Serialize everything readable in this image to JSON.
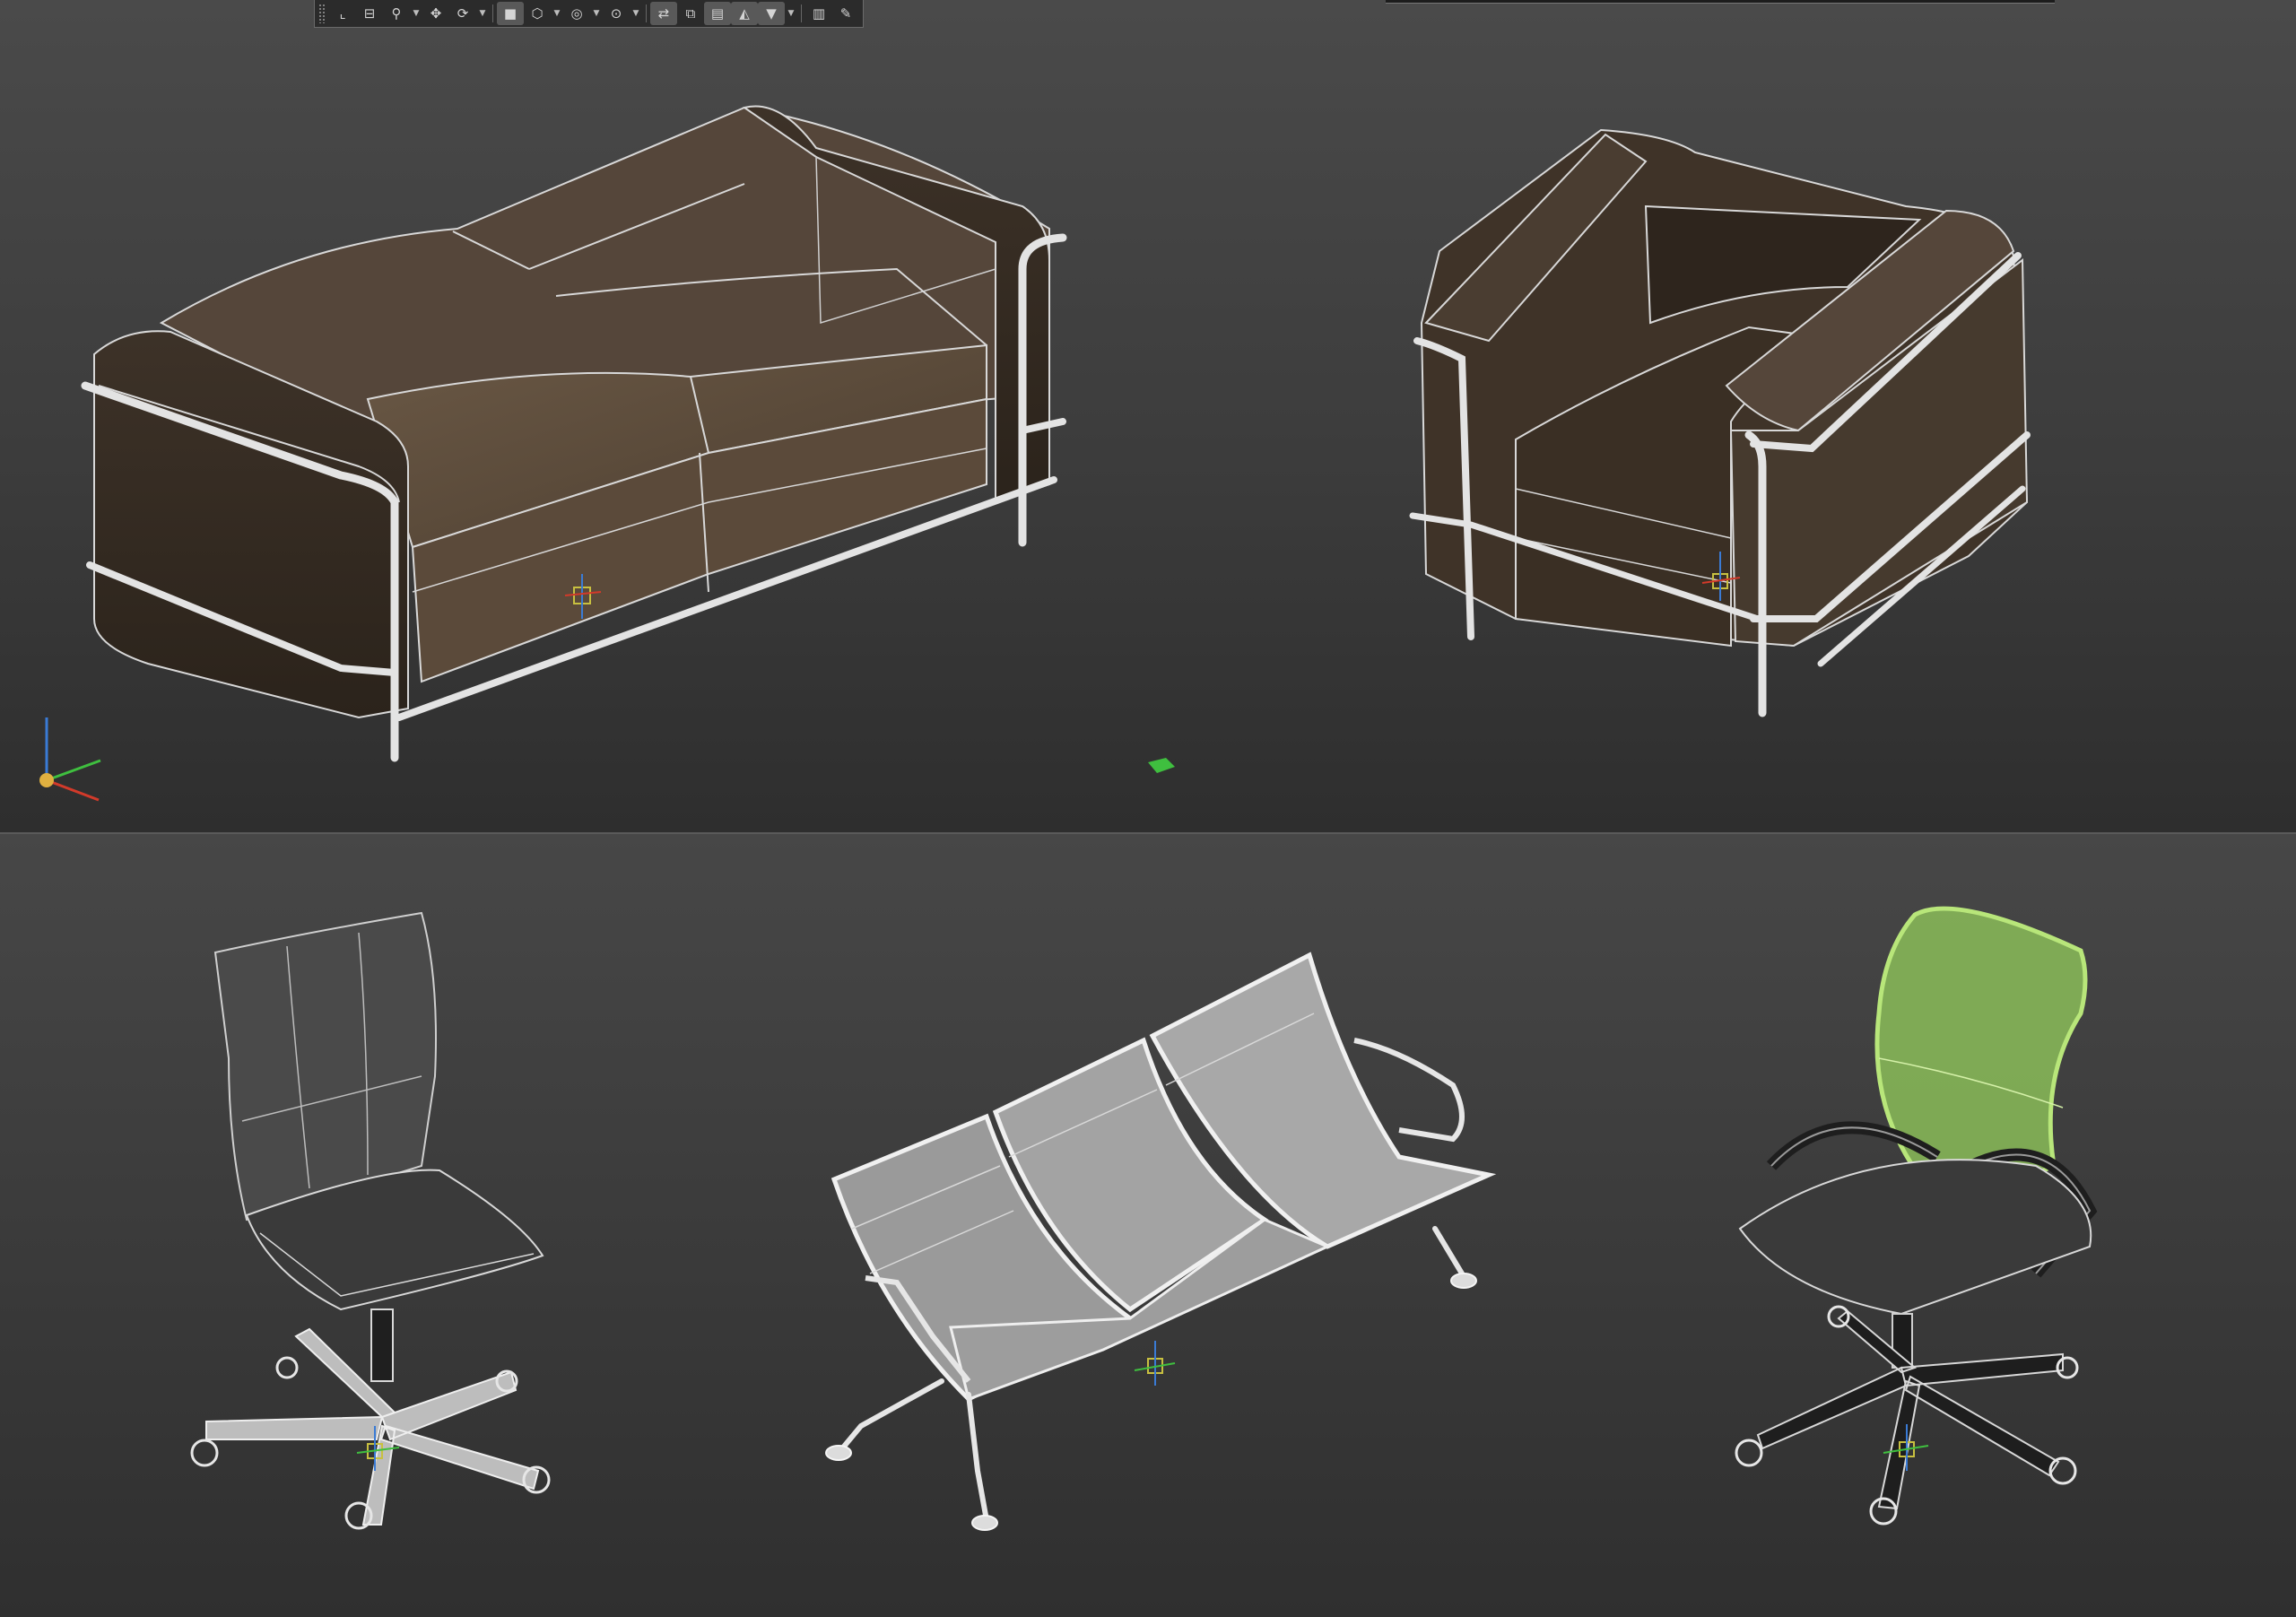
{
  "app": {
    "name": "3D modeling viewport"
  },
  "toolbar": {
    "buttons": [
      {
        "name": "select-object-icon",
        "glyph": "⌞"
      },
      {
        "name": "select-by-name-icon",
        "glyph": "⊟"
      },
      {
        "name": "zoom-icon",
        "glyph": "⚲",
        "dropdown": true
      },
      {
        "name": "pan-icon",
        "glyph": "✥"
      },
      {
        "name": "orbit-icon",
        "glyph": "⟳",
        "dropdown": true
      },
      {
        "name": "shaded-mode-icon",
        "glyph": "■",
        "active": true
      },
      {
        "name": "wireframe-mode-icon",
        "glyph": "⬡",
        "dropdown": true
      },
      {
        "name": "isolate-icon",
        "glyph": "◎",
        "dropdown": true
      },
      {
        "name": "hide-icon",
        "glyph": "⊙",
        "dropdown": true
      },
      {
        "name": "snap-icon",
        "glyph": "⇄",
        "active": true
      },
      {
        "name": "align-icon",
        "glyph": "⧉"
      },
      {
        "name": "layer-manager-icon",
        "glyph": "▤",
        "active": true
      },
      {
        "name": "scene-explorer-icon",
        "glyph": "◭",
        "active": true
      },
      {
        "name": "filter-icon",
        "glyph": "▼",
        "active": true,
        "dropdown": true
      },
      {
        "name": "render-setup-icon",
        "glyph": "▥"
      },
      {
        "name": "eyedropper-icon",
        "glyph": "✎"
      }
    ]
  },
  "colors": {
    "sofa_leather": "#5a4a38",
    "sofa_dark": "#33291f",
    "chrome": "#dcdcdc",
    "selected_green": "#8fc45a",
    "mesh_grey": "#8a8a8a",
    "axis_x": "#d23a2a",
    "axis_y": "#3fbf3f",
    "axis_z": "#3a7bd5"
  },
  "scene": {
    "objects": [
      {
        "name": "two-seat-sofa",
        "selected": false
      },
      {
        "name": "armchair",
        "selected": false
      },
      {
        "name": "office-swivel-chair",
        "selected": false
      },
      {
        "name": "three-seat-bench",
        "selected": false
      },
      {
        "name": "mesh-office-chair",
        "selected": true
      }
    ]
  }
}
